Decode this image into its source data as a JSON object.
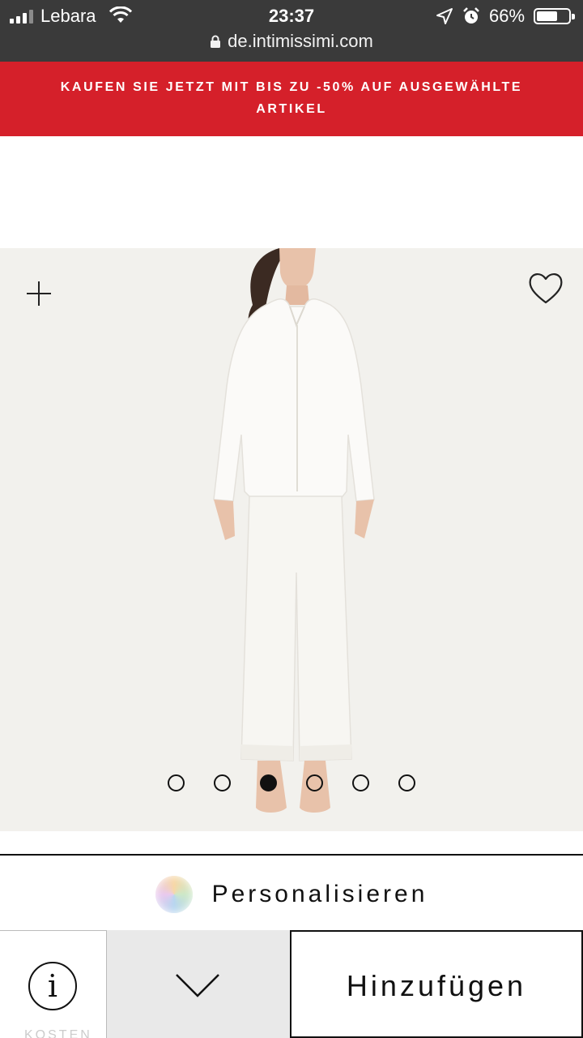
{
  "status_bar": {
    "carrier": "Lebara",
    "time": "23:37",
    "battery_percent": "66%",
    "battery_level": 0.66
  },
  "browser": {
    "url": "de.intimissimi.com"
  },
  "promo": {
    "text": "KAUFEN SIE JETZT MIT BIS ZU -50% AUF AUSGEWÄHLTE ARTIKEL",
    "background": "#d5202a"
  },
  "product": {
    "gallery": {
      "image_count": 6,
      "active_index": 2,
      "zoom_icon": "plus-icon",
      "favorite_icon": "heart-outline-icon"
    }
  },
  "personalize": {
    "label": "Personalisieren"
  },
  "action_bar": {
    "info_symbol": "i",
    "faded_text": "KOSTEN",
    "size_icon": "chevron-down-icon",
    "add_label": "Hinzufügen"
  }
}
